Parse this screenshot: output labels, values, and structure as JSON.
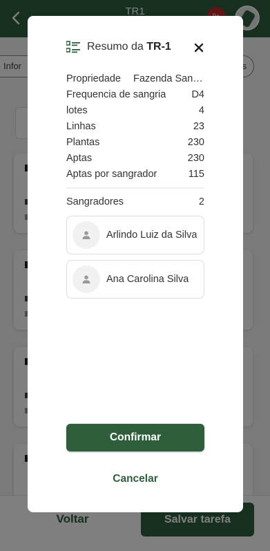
{
  "app": {
    "title": "TR1",
    "notification_count": "9+",
    "tabs_left_label": "Infor",
    "tabs_right_label": "s",
    "footer": {
      "back_label": "Voltar",
      "save_label": "Salvar tarefa"
    }
  },
  "modal": {
    "title_prefix": "Resumo da ",
    "title_task": "TR-1",
    "rows": [
      {
        "label": "Propriedade",
        "value": "Fazenda Santa…"
      },
      {
        "label": "Frequencia de sangria",
        "value": "D4"
      },
      {
        "label": "lotes",
        "value": "4"
      },
      {
        "label": "Linhas",
        "value": "23"
      },
      {
        "label": "Plantas",
        "value": "230"
      },
      {
        "label": "Aptas",
        "value": "230"
      },
      {
        "label": "Aptas por sangrador",
        "value": "115"
      }
    ],
    "tappers": {
      "label": "Sangradores",
      "count": "2"
    },
    "people": [
      {
        "name": "Arlindo Luiz da Silva"
      },
      {
        "name": "Ana Carolina Silva"
      }
    ],
    "confirm_label": "Confirmar",
    "cancel_label": "Cancelar"
  },
  "colors": {
    "primary": "#2f5e3c",
    "badge": "#c62828"
  }
}
